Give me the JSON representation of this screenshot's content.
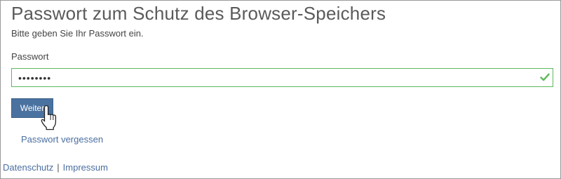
{
  "page": {
    "title": "Passwort zum Schutz des Browser-Speichers",
    "subtitle": "Bitte geben Sie Ihr Passwort ein."
  },
  "form": {
    "password_label": "Passwort",
    "password_value": "mypasswd",
    "password_valid": true,
    "submit_label": "Weiter",
    "forgot_link": "Passwort vergessen"
  },
  "footer": {
    "privacy": "Datenschutz",
    "separator": "|",
    "imprint": "Impressum"
  },
  "icons": {
    "valid": "check-icon",
    "pointer": "hand-pointer-icon"
  },
  "colors": {
    "valid": "#5cb85c",
    "button": "#4a72a0",
    "link": "#4a6ea0"
  }
}
